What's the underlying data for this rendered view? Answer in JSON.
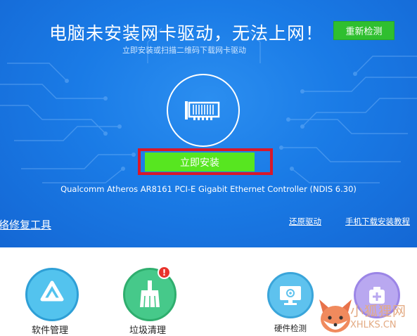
{
  "header": {
    "title": "电脑未安装网卡驱动，无法上网！",
    "subtitle": "立即安装或扫描二维码下载网卡驱动",
    "recheck_label": "重新检测"
  },
  "install": {
    "button_label": "立即安装"
  },
  "device_name": "Qualcomm Atheros AR8161 PCI-E Gigabit Ethernet Controller (NDIS 6.30)",
  "links": {
    "repair_tool": "络修复工具",
    "restore_driver": "还原驱动",
    "phone_tutorial": "手机下载安装教程"
  },
  "tools": {
    "software": "软件管理",
    "cleanup": "垃圾清理",
    "cleanup_badge": "!",
    "hardware": "硬件检测"
  },
  "watermark": {
    "brand": "小狐狸网",
    "url": "XHLKS.CN"
  },
  "colors": {
    "hero_blue": "#1a7be6",
    "install_green": "#57e620",
    "highlight_red": "#d8182a",
    "recheck_green": "#2fbf2f"
  }
}
